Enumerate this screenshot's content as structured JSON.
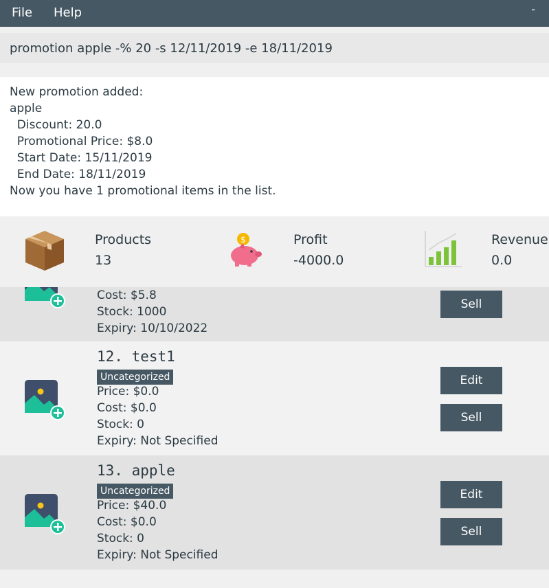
{
  "menu": {
    "file": "File",
    "help": "Help",
    "minimize": "-"
  },
  "command": {
    "value": "promotion apple -% 20 -s 12/11/2019 -e 18/11/2019"
  },
  "result_lines": [
    "New promotion added:",
    "apple",
    "  Discount: 20.0",
    "  Promotional Price: $8.0",
    "  Start Date: 15/11/2019",
    "  End Date: 18/11/2019",
    "Now you have 1 promotional items in the list."
  ],
  "stats": {
    "products_label": "Products",
    "products_value": "13",
    "profit_label": "Profit",
    "profit_value": "-4000.0",
    "revenue_label": "Revenue",
    "revenue_value": "0.0"
  },
  "items": [
    {
      "cost": "Cost: $5.8",
      "stock": "Stock: 1000",
      "expiry": "Expiry: 10/10/2022",
      "sell": "Sell"
    },
    {
      "title": "12.  test1",
      "category": "Uncategorized",
      "price": "Price: $0.0",
      "cost": "Cost: $0.0",
      "stock": "Stock: 0",
      "expiry": "Expiry: Not Specified",
      "edit": "Edit",
      "sell": "Sell"
    },
    {
      "title": "13.  apple",
      "category": "Uncategorized",
      "price": "Price: $40.0",
      "cost": "Cost: $0.0",
      "stock": "Stock: 0",
      "expiry": "Expiry: Not Specified",
      "edit": "Edit",
      "sell": "Sell"
    }
  ],
  "icons": {
    "products": "box-icon",
    "profit": "piggy-bank-icon",
    "revenue": "bar-chart-icon",
    "item_image": "add-image-icon"
  },
  "colors": {
    "header": "#465863",
    "accent_green": "#1dbf98",
    "coin": "#f5b800",
    "pig": "#f06e8c",
    "chart_green": "#7cc23a"
  }
}
